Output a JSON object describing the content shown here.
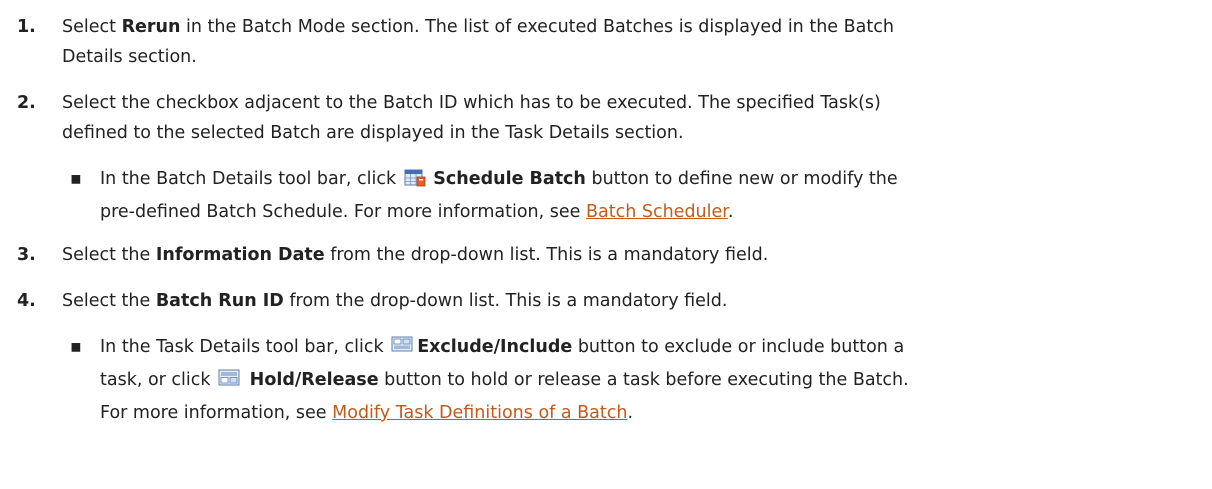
{
  "steps": [
    {
      "num": "1.",
      "pre": "Select ",
      "bold": "Rerun",
      "post": " in the Batch Mode section. The list of executed Batches is displayed in the Batch",
      "line2": "Details section."
    },
    {
      "num": "2.",
      "line1": "Select the checkbox adjacent to the Batch ID which has to be executed. The specified Task(s)",
      "line2": "defined to the selected Batch are displayed in the Task Details section."
    },
    {
      "num": "3.",
      "pre": "Select the ",
      "bold": "Information Date",
      "post": " from the drop-down list. This is a mandatory field."
    },
    {
      "num": "4.",
      "pre": "Select the ",
      "bold": "Batch Run ID",
      "post": " from the drop-down list. This is a mandatory field."
    }
  ],
  "bullet_a": {
    "mark": "▪",
    "pre": "In the Batch Details tool bar, click ",
    "icon": "schedule-batch-icon",
    "bold": "Schedule Batch",
    "post": " button to define new or modify the",
    "line2": "pre-defined Batch Schedule. For more information, see ",
    "link": "Batch Scheduler",
    "end": "."
  },
  "bullet_b": {
    "mark": "▪",
    "pre": "In the Task Details tool bar, click ",
    "icon1": "exclude-include-icon",
    "bold1": "Exclude/Include",
    "post1": " button to exclude or include button a",
    "line2_pre": "task, or click ",
    "icon2": "hold-release-icon",
    "bold2": "Hold/Release",
    "line2_post": " button to hold or release a task before executing the Batch.",
    "line3_pre": "For more information, see ",
    "link": "Modify Task Definitions of a Batch",
    "end": "."
  },
  "colors": {
    "text": "#222222",
    "link": "#c45a1a"
  }
}
